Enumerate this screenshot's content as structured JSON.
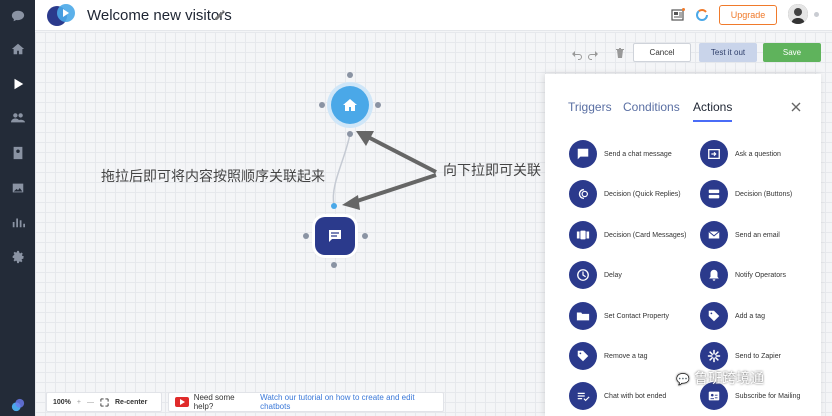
{
  "header": {
    "title": "Welcome new visitors",
    "upgrade_label": "Upgrade"
  },
  "sidebar": {
    "items": [
      {
        "icon": "chat-bubble-icon"
      },
      {
        "icon": "home-icon"
      },
      {
        "icon": "play-icon"
      },
      {
        "icon": "users-icon"
      },
      {
        "icon": "contacts-icon"
      },
      {
        "icon": "gallery-icon"
      },
      {
        "icon": "reports-icon"
      },
      {
        "icon": "settings-icon"
      },
      {
        "icon": "logo-icon"
      }
    ]
  },
  "toolbar": {
    "cancel_label": "Cancel",
    "test_label": "Test it out",
    "save_label": "Save"
  },
  "annotations": {
    "left_text": "拖拉后即可将内容按照顺序关联起来",
    "right_text": "向下拉即可关联"
  },
  "panel": {
    "tabs": [
      "Triggers",
      "Conditions",
      "Actions"
    ],
    "active_tab": "Actions",
    "actions": [
      {
        "label": "Send a chat message",
        "icon": "chat-message-icon"
      },
      {
        "label": "Ask a question",
        "icon": "question-input-icon"
      },
      {
        "label": "Decision (Quick Replies)",
        "icon": "quick-replies-icon"
      },
      {
        "label": "Decision (Buttons)",
        "icon": "buttons-icon"
      },
      {
        "label": "Decision (Card Messages)",
        "icon": "card-messages-icon"
      },
      {
        "label": "Send an email",
        "icon": "email-icon"
      },
      {
        "label": "Delay",
        "icon": "clock-icon"
      },
      {
        "label": "Notify Operators",
        "icon": "bell-icon"
      },
      {
        "label": "Set Contact Property",
        "icon": "folder-icon"
      },
      {
        "label": "Add a tag",
        "icon": "tag-icon"
      },
      {
        "label": "Remove a tag",
        "icon": "tag-remove-icon"
      },
      {
        "label": "Send to Zapier",
        "icon": "zapier-icon"
      },
      {
        "label": "Chat with bot ended",
        "icon": "chat-ended-icon"
      },
      {
        "label": "Subscribe for Mailing",
        "icon": "subscribe-icon"
      }
    ]
  },
  "bottom": {
    "zoom": "100%",
    "recenter_label": "Re-center",
    "help_text": "Need some help?",
    "help_link": "Watch our tutorial on how to create and edit chatbots"
  },
  "watermark": "鲁班跨境通",
  "colors": {
    "sidebar": "#232b38",
    "accent": "#2b3a8c",
    "start_node": "#4aa8e8",
    "save": "#5fb35c",
    "upgrade": "#f07a2b"
  }
}
